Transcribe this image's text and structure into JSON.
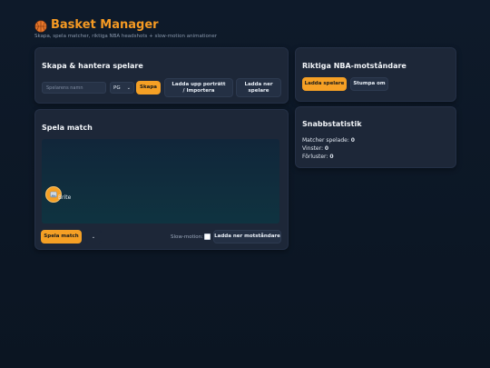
{
  "app": {
    "title": "Basket Manager",
    "subtitle": "Skapa, spela matcher, riktiga NBA headshots + slow-motion animationer"
  },
  "players_card": {
    "title": "Skapa & hantera spelare",
    "name_placeholder": "Spelarens namn",
    "position_value": "PG",
    "create_label": "Skapa",
    "upload_label": "Ladda upp porträtt / Importera",
    "download_label": "Ladda ner spelare"
  },
  "nba_card": {
    "title": "Riktiga NBA-motståndare",
    "load_label": "Ladda spelare",
    "stop_label": "Stumpa om"
  },
  "match_card": {
    "title": "Spela match",
    "player_name": "Brite",
    "play_label": "Spela match",
    "slow_motion_label": "Slow-motion:",
    "download_opponents_label": "Ladda ner motståndare"
  },
  "stats_card": {
    "title": "Snabbstatistik",
    "played_label": "Matcher spelade:",
    "played_value": "0",
    "wins_label": "Vinster:",
    "wins_value": "0",
    "losses_label": "Förluster:",
    "losses_value": "0"
  },
  "colors": {
    "accent": "#f59a23",
    "background": "#0e1a2a",
    "card": "#1d2738"
  },
  "icons": [
    "basketball-icon",
    "chevron-down-icon",
    "image-icon"
  ]
}
